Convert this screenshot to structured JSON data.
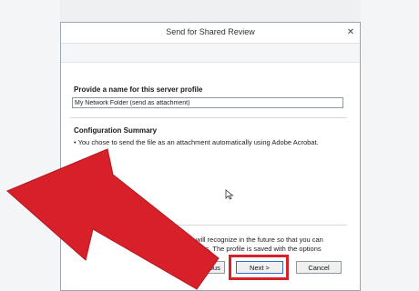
{
  "dialog": {
    "title": "Send for Shared Review",
    "close_glyph": "✕"
  },
  "profile": {
    "label": "Provide a name for this server profile",
    "value": "My Network Folder (send as attachment)"
  },
  "summary": {
    "label": "Configuration Summary",
    "text": "• You chose to send the file as an attachment automatically using Adobe Acrobat."
  },
  "help": {
    "line1": "you will recognize in the future so that you can",
    "line2": "ributions. The profile is saved with the options"
  },
  "buttons": {
    "previous": "< Previous",
    "next": "Next >",
    "cancel": "Cancel"
  },
  "colors": {
    "annotation_arrow": "#d8202a",
    "highlight_box": "#d8202a"
  }
}
